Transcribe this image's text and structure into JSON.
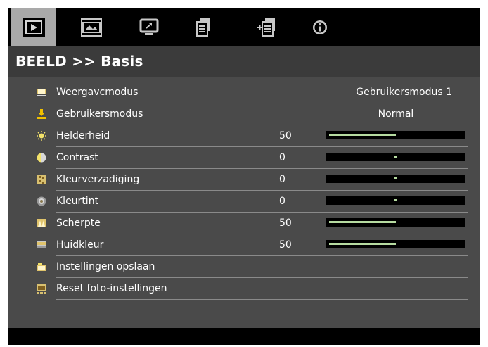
{
  "header": {
    "title": "BEELD >> Basis",
    "tabs": [
      {
        "icon": "play-screen-icon",
        "active": true
      },
      {
        "icon": "film-image-icon",
        "active": false
      },
      {
        "icon": "display-settings-icon",
        "active": false
      },
      {
        "icon": "document-settings-icon",
        "active": false
      },
      {
        "icon": "document-add-icon",
        "active": false
      },
      {
        "icon": "info-icon",
        "active": false
      }
    ]
  },
  "menu": {
    "items": [
      {
        "label": "Weergavcmodus",
        "value": "Gebruikersmodus 1",
        "icon": "display-mode-icon"
      },
      {
        "label": "Gebruikersmodus",
        "value": "Normal",
        "icon": "download-icon"
      },
      {
        "label": "Helderheid",
        "value": "50",
        "level": 0.5,
        "icon": "sun-icon"
      },
      {
        "label": "Contrast",
        "value": "0",
        "level": 0.5,
        "icon": "contrast-icon"
      },
      {
        "label": "Kleurverzadiging",
        "value": "0",
        "level": 0.5,
        "icon": "saturation-icon"
      },
      {
        "label": "Kleurtint",
        "value": "0",
        "level": 0.5,
        "icon": "tint-icon"
      },
      {
        "label": "Scherpte",
        "value": "50",
        "level": 0.5,
        "icon": "sharpness-icon"
      },
      {
        "label": "Huidkleur",
        "value": "50",
        "level": 0.5,
        "icon": "skin-color-icon"
      },
      {
        "label": "Instellingen opslaan",
        "icon": "save-settings-icon"
      },
      {
        "label": "Reset foto-instellingen",
        "icon": "reset-photo-icon"
      }
    ]
  },
  "colors": {
    "slider_fill": "#b6dba0",
    "active_tab": "#a9a9a9",
    "menu_bg": "#4a4a4a"
  }
}
